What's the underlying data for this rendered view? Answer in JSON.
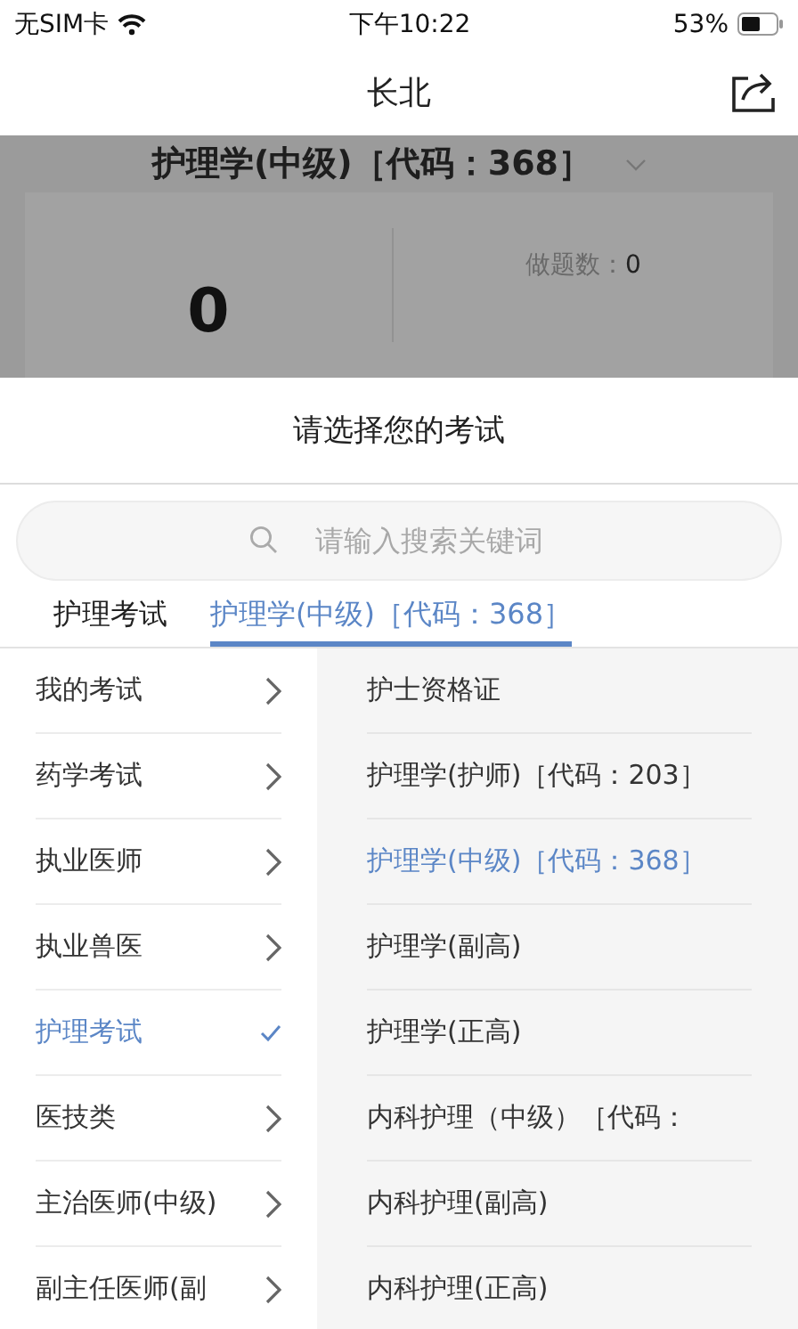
{
  "status_bar": {
    "carrier": "无SIM卡",
    "time": "下午10:22",
    "battery": "53%"
  },
  "nav": {
    "title": "长北"
  },
  "background": {
    "exam_title": "护理学(中级)［代码：368］",
    "score": "0",
    "stat_label": "做题数：",
    "stat_value": "0"
  },
  "sheet": {
    "title": "请选择您的考试",
    "search": {
      "placeholder": "请输入搜索关键词"
    },
    "tabs": [
      {
        "label": "护理考试",
        "selected": false
      },
      {
        "label": "护理学(中级)［代码：368］",
        "selected": true
      }
    ],
    "categories": [
      {
        "label": "我的考试",
        "selected": false
      },
      {
        "label": "药学考试",
        "selected": false
      },
      {
        "label": "执业医师",
        "selected": false
      },
      {
        "label": "执业兽医",
        "selected": false
      },
      {
        "label": "护理考试",
        "selected": true
      },
      {
        "label": "医技类",
        "selected": false
      },
      {
        "label": "主治医师(中级)",
        "selected": false
      },
      {
        "label": "副主任医师(副",
        "selected": false
      }
    ],
    "exams": [
      {
        "label": "护士资格证",
        "selected": false
      },
      {
        "label": "护理学(护师)［代码：203］",
        "selected": false
      },
      {
        "label": "护理学(中级)［代码：368］",
        "selected": true
      },
      {
        "label": "护理学(副高)",
        "selected": false
      },
      {
        "label": "护理学(正高)",
        "selected": false
      },
      {
        "label": "内科护理（中级）［代码：",
        "selected": false
      },
      {
        "label": "内科护理(副高)",
        "selected": false
      },
      {
        "label": "内科护理(正高)",
        "selected": false
      }
    ]
  }
}
